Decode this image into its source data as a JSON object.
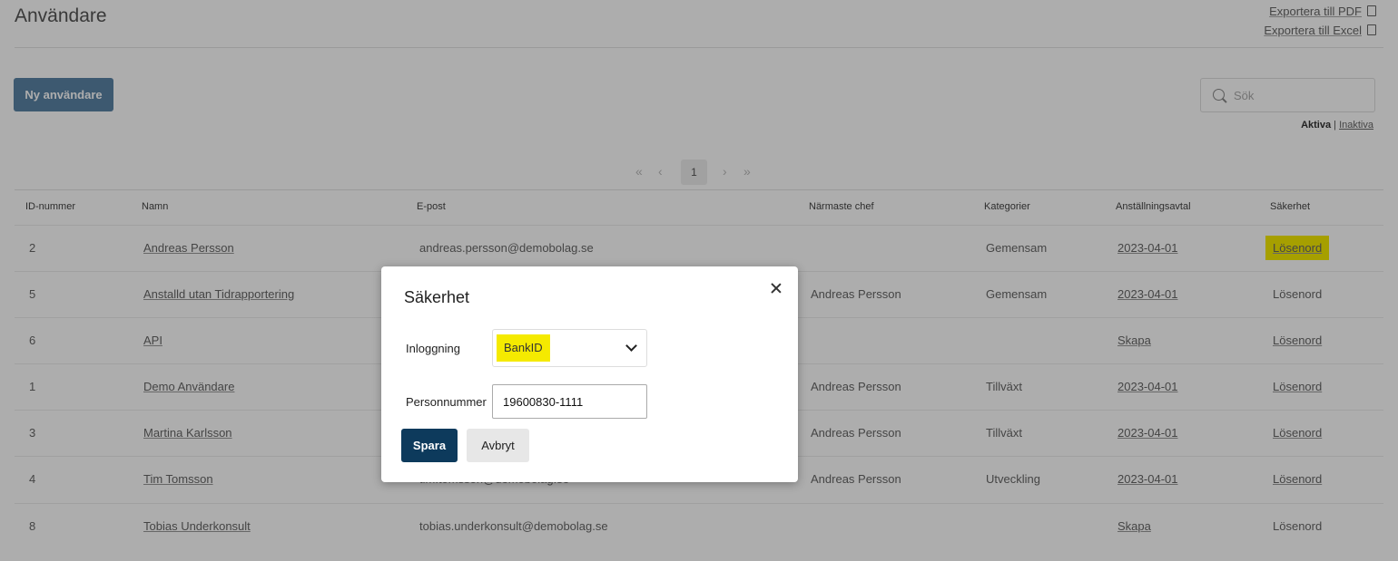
{
  "page": {
    "title": "Användare",
    "export_pdf": "Exportera till PDF",
    "export_excel": "Exportera till Excel",
    "new_user_button": "Ny användare",
    "search_placeholder": "Sök",
    "filter_active": "Aktiva",
    "filter_separator": "|",
    "filter_inactive": "Inaktiva",
    "pager": {
      "first": "«",
      "prev": "‹",
      "current": "1",
      "next": "›",
      "last": "»"
    }
  },
  "table": {
    "headers": [
      "ID-nummer",
      "Namn",
      "E-post",
      "Närmaste chef",
      "Kategorier",
      "Anställningsavtal",
      "Säkerhet"
    ],
    "rows": [
      {
        "id": "2",
        "name": "Andreas Persson",
        "email": "andreas.persson@demobolag.se",
        "manager": "",
        "category": "Gemensam",
        "contract": "2023-04-01",
        "security": "Lösenord"
      },
      {
        "id": "5",
        "name": "Anstalld utan Tidrapportering",
        "email": "",
        "manager": "Andreas Persson",
        "category": "Gemensam",
        "contract": "2023-04-01",
        "security": "Lösenord"
      },
      {
        "id": "6",
        "name": "API",
        "email": "",
        "manager": "",
        "category": "",
        "contract": "Skapa",
        "security": "Lösenord"
      },
      {
        "id": "1",
        "name": "Demo Användare",
        "email": "",
        "manager": "Andreas Persson",
        "category": "Tillväxt",
        "contract": "2023-04-01",
        "security": "Lösenord"
      },
      {
        "id": "3",
        "name": "Martina Karlsson",
        "email": "",
        "manager": "Andreas Persson",
        "category": "Tillväxt",
        "contract": "2023-04-01",
        "security": "Lösenord"
      },
      {
        "id": "4",
        "name": "Tim Tomsson",
        "email": "tim.tomsson@demobolag.se",
        "manager": "Andreas Persson",
        "category": "Utveckling",
        "contract": "2023-04-01",
        "security": "Lösenord"
      },
      {
        "id": "8",
        "name": "Tobias Underkonsult",
        "email": "tobias.underkonsult@demobolag.se",
        "manager": "",
        "category": "",
        "contract": "Skapa",
        "security": "Lösenord"
      }
    ]
  },
  "modal": {
    "title": "Säkerhet",
    "login_label": "Inloggning",
    "login_value": "BankID",
    "pnr_label": "Personnummer",
    "pnr_value": "19600830-1111",
    "save_label": "Spara",
    "cancel_label": "Avbryt"
  },
  "colors": {
    "highlight": "#f5ea00",
    "primary_button": "#0d3a5c",
    "new_user_button": "#5a83a6"
  }
}
